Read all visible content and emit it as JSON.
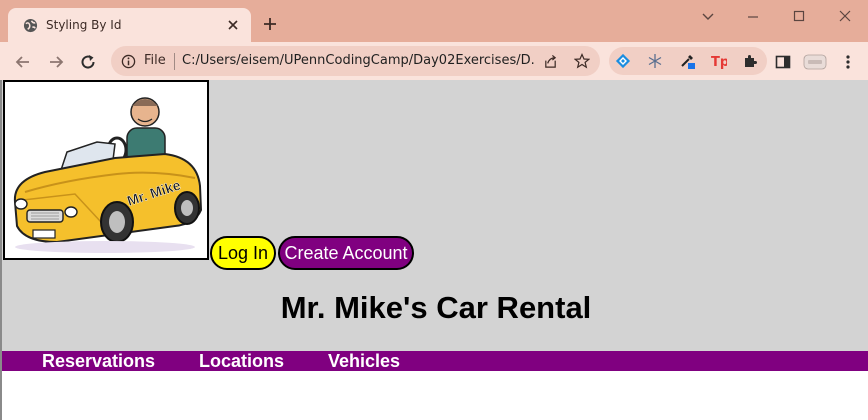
{
  "browser": {
    "tab_title": "Styling By Id",
    "address_scheme_label": "File",
    "url": "C:/Users/eisem/UPennCodingCamp/Day02Exercises/D...",
    "theme_color": "#e6ad9a"
  },
  "header": {
    "logo_caption": "Mr. Mike",
    "login_label": "Log In",
    "create_account_label": "Create Account",
    "site_title": "Mr. Mike's Car Rental",
    "background_color": "#d3d3d3",
    "login_color": "#ffff00",
    "create_account_color": "#800080"
  },
  "nav": {
    "color": "#800080",
    "items": [
      {
        "label": "Reservations"
      },
      {
        "label": "Locations"
      },
      {
        "label": "Vehicles"
      }
    ]
  }
}
